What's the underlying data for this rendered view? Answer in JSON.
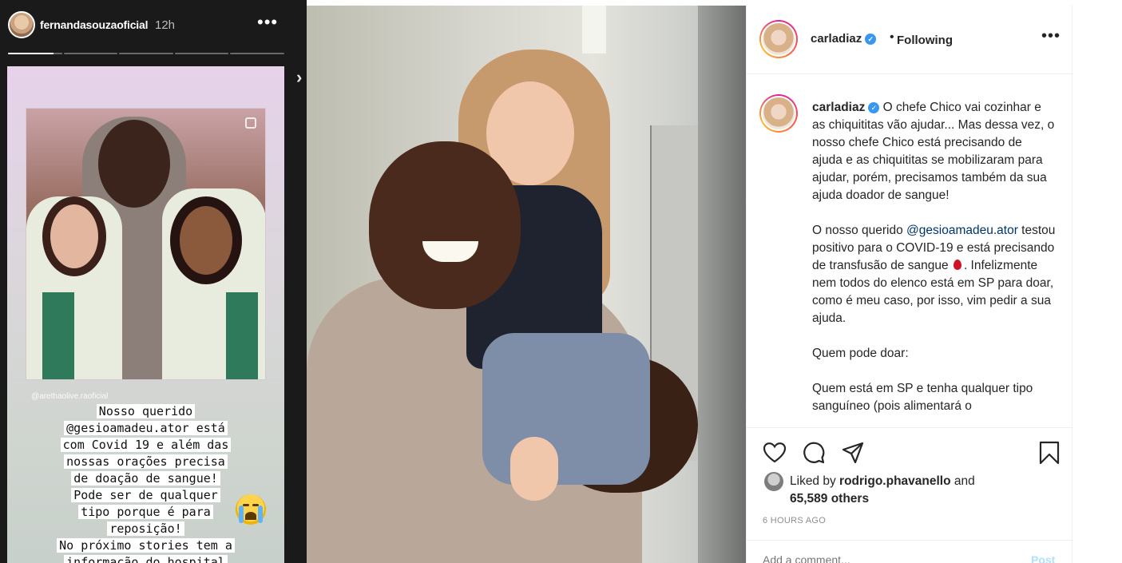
{
  "story": {
    "username": "fernandasouzaoficial",
    "time": "12h",
    "more_icon": "more-horizontal-icon",
    "next_icon": "chevron-right-icon",
    "progress": [
      1,
      0,
      0,
      0,
      0
    ],
    "progress_current_fraction": 0.85,
    "photo_credit": "@arethaolive.raoficial",
    "text_lines": [
      "Nosso querido",
      "@gesioamadeu.ator está",
      "com Covid 19 e além das",
      "nossas orações precisa",
      "de doação de sangue!",
      "Pode ser de qualquer",
      "tipo porque é para",
      "reposição!",
      "No próximo stories tem a",
      "informação do hospital"
    ],
    "emoji": "crying-face-emoji"
  },
  "post": {
    "username": "carladiaz",
    "verified": "✓",
    "separator": "•",
    "follow_status": "Following",
    "caption": {
      "p1": "O chefe Chico vai cozinhar e as chiquititas vão ajudar... Mas dessa vez, o nosso chefe Chico está precisando de ajuda e as chiquititas se mobilizaram para ajudar, porém, precisamos também da sua ajuda doador de sangue!",
      "p2_before": "O nosso querido ",
      "p2_mention": "@gesioamadeu.ator",
      "p2_middle": " testou positivo para o COVID-19 e está precisando de transfusão de sangue ",
      "p2_after": ". Infelizmente nem todos do elenco está em SP para doar, como é meu caso, por isso, vim pedir a sua ajuda.",
      "p3": "Quem pode doar:",
      "p4": "Quem está em SP e tenha qualquer tipo sanguíneo (pois alimentará o"
    },
    "likes": {
      "prefix": "Liked by ",
      "user": "rodrigo.phavanello",
      "and": " and",
      "others": "65,589 others"
    },
    "timestamp": "6 HOURS AGO",
    "comment_placeholder": "Add a comment...",
    "post_label": "Post"
  },
  "colors": {
    "verified": "#3897f0",
    "link": "#003569",
    "muted": "#8e8e8e"
  }
}
